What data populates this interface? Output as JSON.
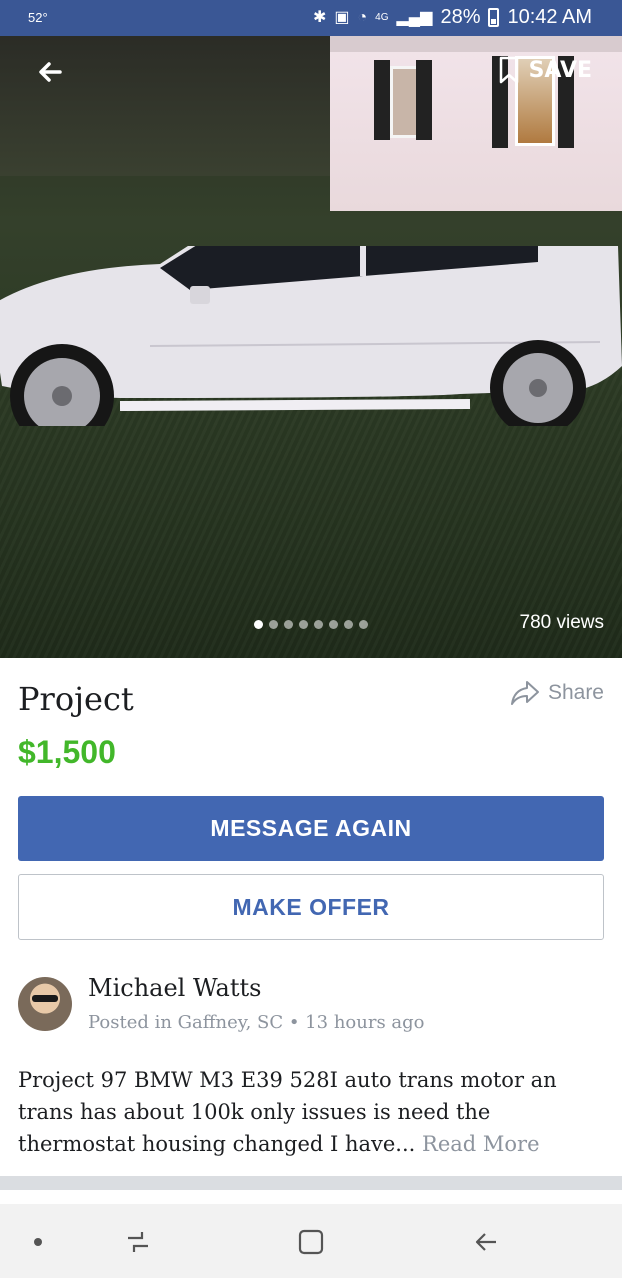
{
  "status_bar": {
    "temperature": "52°",
    "battery_percent": "28%",
    "time": "10:42 AM",
    "icons": [
      "bluetooth-icon",
      "nfc-icon",
      "alarm-icon",
      "4g-lte-icon",
      "signal-icon",
      "battery-icon"
    ]
  },
  "hero": {
    "save_label": "SAVE",
    "views_label": "780 views",
    "photo_count": 8,
    "active_photo_index": 0
  },
  "listing": {
    "title": "Project",
    "share_label": "Share",
    "price": "$1,500",
    "primary_action": "MESSAGE AGAIN",
    "secondary_action": "MAKE OFFER"
  },
  "seller": {
    "name": "Michael Watts",
    "posted": "Posted in Gaffney, SC • 13 hours ago"
  },
  "description": {
    "text": "Project 97 BMW M3 E39 528I auto  trans motor an trans has about 100k  only issues is need the thermostat housing changed I have...",
    "read_more": "Read More"
  },
  "colors": {
    "status_bar": "#3a5795",
    "primary": "#4267b2",
    "price": "#42b72a",
    "muted": "#8d949e"
  }
}
